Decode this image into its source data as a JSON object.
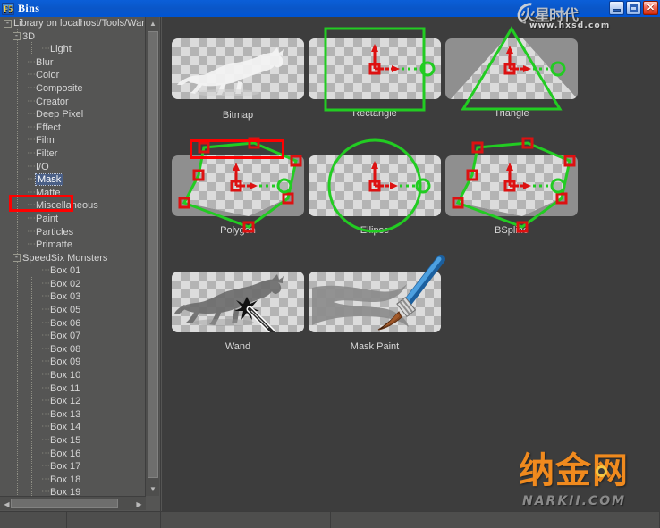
{
  "window": {
    "title": "Bins",
    "icon_label": "F5",
    "icon_name": "fusion-app-icon",
    "controls": [
      {
        "name": "minimize-button",
        "glyph": "_"
      },
      {
        "name": "maximize-button",
        "glyph": "□"
      },
      {
        "name": "close-button",
        "glyph": "✕"
      }
    ]
  },
  "watermarks": {
    "top": {
      "brand": "火星时代",
      "url": "www.hxsd.com"
    },
    "bottom": {
      "brand": "纳金网",
      "url": "NARKII.COM"
    }
  },
  "tree": {
    "root": "Library on localhost/Tools/Warp/T",
    "selected": "Mask",
    "items": [
      {
        "label": "Library on localhost/Tools/Warp/T",
        "indent": 0,
        "expander": "-"
      },
      {
        "label": "3D",
        "indent": 1,
        "expander": "-"
      },
      {
        "label": "Light",
        "indent": 3,
        "expander": ""
      },
      {
        "label": "Blur",
        "indent": 2,
        "expander": ""
      },
      {
        "label": "Color",
        "indent": 2,
        "expander": ""
      },
      {
        "label": "Composite",
        "indent": 2,
        "expander": ""
      },
      {
        "label": "Creator",
        "indent": 2,
        "expander": ""
      },
      {
        "label": "Deep Pixel",
        "indent": 2,
        "expander": ""
      },
      {
        "label": "Effect",
        "indent": 2,
        "expander": ""
      },
      {
        "label": "Film",
        "indent": 2,
        "expander": ""
      },
      {
        "label": "Filter",
        "indent": 2,
        "expander": ""
      },
      {
        "label": "I/O",
        "indent": 2,
        "expander": ""
      },
      {
        "label": "Mask",
        "indent": 2,
        "expander": ""
      },
      {
        "label": "Matte",
        "indent": 2,
        "expander": ""
      },
      {
        "label": "Miscellaneous",
        "indent": 2,
        "expander": ""
      },
      {
        "label": "Paint",
        "indent": 2,
        "expander": ""
      },
      {
        "label": "Particles",
        "indent": 2,
        "expander": ""
      },
      {
        "label": "Primatte",
        "indent": 2,
        "expander": ""
      },
      {
        "label": "SpeedSix Monsters",
        "indent": 1,
        "expander": "-"
      },
      {
        "label": "Box 01",
        "indent": 3,
        "expander": ""
      },
      {
        "label": "Box 02",
        "indent": 3,
        "expander": ""
      },
      {
        "label": "Box 03",
        "indent": 3,
        "expander": ""
      },
      {
        "label": "Box 05",
        "indent": 3,
        "expander": ""
      },
      {
        "label": "Box 06",
        "indent": 3,
        "expander": ""
      },
      {
        "label": "Box 07",
        "indent": 3,
        "expander": ""
      },
      {
        "label": "Box 08",
        "indent": 3,
        "expander": ""
      },
      {
        "label": "Box 09",
        "indent": 3,
        "expander": ""
      },
      {
        "label": "Box 10",
        "indent": 3,
        "expander": ""
      },
      {
        "label": "Box 11",
        "indent": 3,
        "expander": ""
      },
      {
        "label": "Box 12",
        "indent": 3,
        "expander": ""
      },
      {
        "label": "Box 13",
        "indent": 3,
        "expander": ""
      },
      {
        "label": "Box 14",
        "indent": 3,
        "expander": ""
      },
      {
        "label": "Box 15",
        "indent": 3,
        "expander": ""
      },
      {
        "label": "Box 16",
        "indent": 3,
        "expander": ""
      },
      {
        "label": "Box 17",
        "indent": 3,
        "expander": ""
      },
      {
        "label": "Box 18",
        "indent": 3,
        "expander": ""
      },
      {
        "label": "Box 19",
        "indent": 3,
        "expander": ""
      }
    ]
  },
  "tools": [
    {
      "label": "Bitmap",
      "icon": "bitmap-horse-thumbnail",
      "highlighted": true
    },
    {
      "label": "Rectangle",
      "icon": "rectangle-mask-thumbnail",
      "highlighted": false
    },
    {
      "label": "Triangle",
      "icon": "triangle-mask-thumbnail",
      "highlighted": false
    },
    {
      "label": "Polygon",
      "icon": "polygon-mask-thumbnail",
      "highlighted": false
    },
    {
      "label": "Ellipse",
      "icon": "ellipse-mask-thumbnail",
      "highlighted": false
    },
    {
      "label": "BSpline",
      "icon": "bspline-mask-thumbnail",
      "highlighted": false
    },
    {
      "label": "Wand",
      "icon": "wand-thumbnail",
      "highlighted": false
    },
    {
      "label": "Mask Paint",
      "icon": "mask-paint-thumbnail",
      "highlighted": false
    }
  ],
  "colors": {
    "titlebar": "#0a56c8",
    "panel": "#555554",
    "content": "#3d3d3d",
    "mask_outline": "#22cc22",
    "handle": "#dd1111",
    "highlight_box": "#ff0000",
    "selection": "#4a5f86",
    "narkii_orange": "#f08a1e"
  },
  "scrollbars": {
    "vertical_arrow_up": "▲",
    "vertical_arrow_down": "▼",
    "horizontal_arrow_left": "◀",
    "horizontal_arrow_right": "▶"
  }
}
